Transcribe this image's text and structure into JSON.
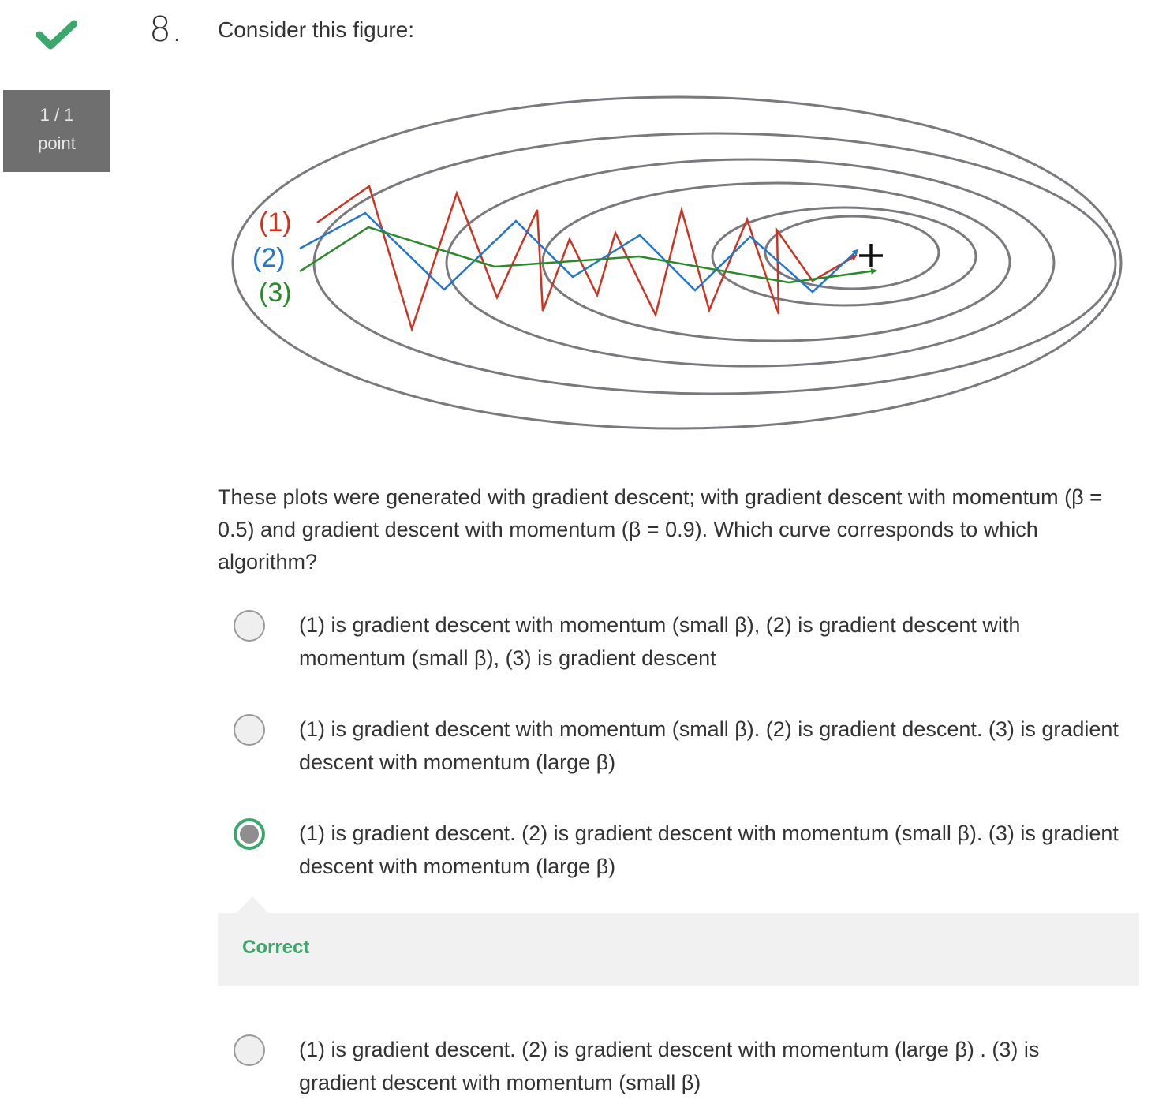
{
  "status": {
    "icon": "checkmark-icon",
    "color": "#3aa86b"
  },
  "score": {
    "line1": "1 / 1",
    "line2": "point"
  },
  "question": {
    "number": "8.",
    "title": "Consider this figure:",
    "prompt": "These plots were generated with gradient descent; with gradient descent with momentum (β = 0.5) and gradient descent with momentum (β = 0.9). Which curve corresponds to which algorithm?"
  },
  "figure": {
    "labels": [
      "(1)",
      "(2)",
      "(3)"
    ],
    "label_colors": [
      "#cc3322",
      "#2277cc",
      "#2a8a2a"
    ],
    "minimum_marker": "+"
  },
  "options": [
    {
      "text": "(1) is gradient descent with momentum (small β), (2) is gradient descent with momentum (small β), (3) is gradient descent",
      "selected": false
    },
    {
      "text": "(1) is gradient descent with momentum (small β). (2) is gradient descent. (3) is gradient descent with momentum (large β)",
      "selected": false
    },
    {
      "text": "(1) is gradient descent. (2) is gradient descent with momentum (small β). (3) is gradient descent with momentum (large β)",
      "selected": true
    },
    {
      "text": "(1) is gradient descent. (2) is gradient descent with momentum (large β) . (3) is gradient descent with momentum (small β)",
      "selected": false
    }
  ],
  "feedback": {
    "label": "Correct",
    "color": "#3aa86b"
  }
}
